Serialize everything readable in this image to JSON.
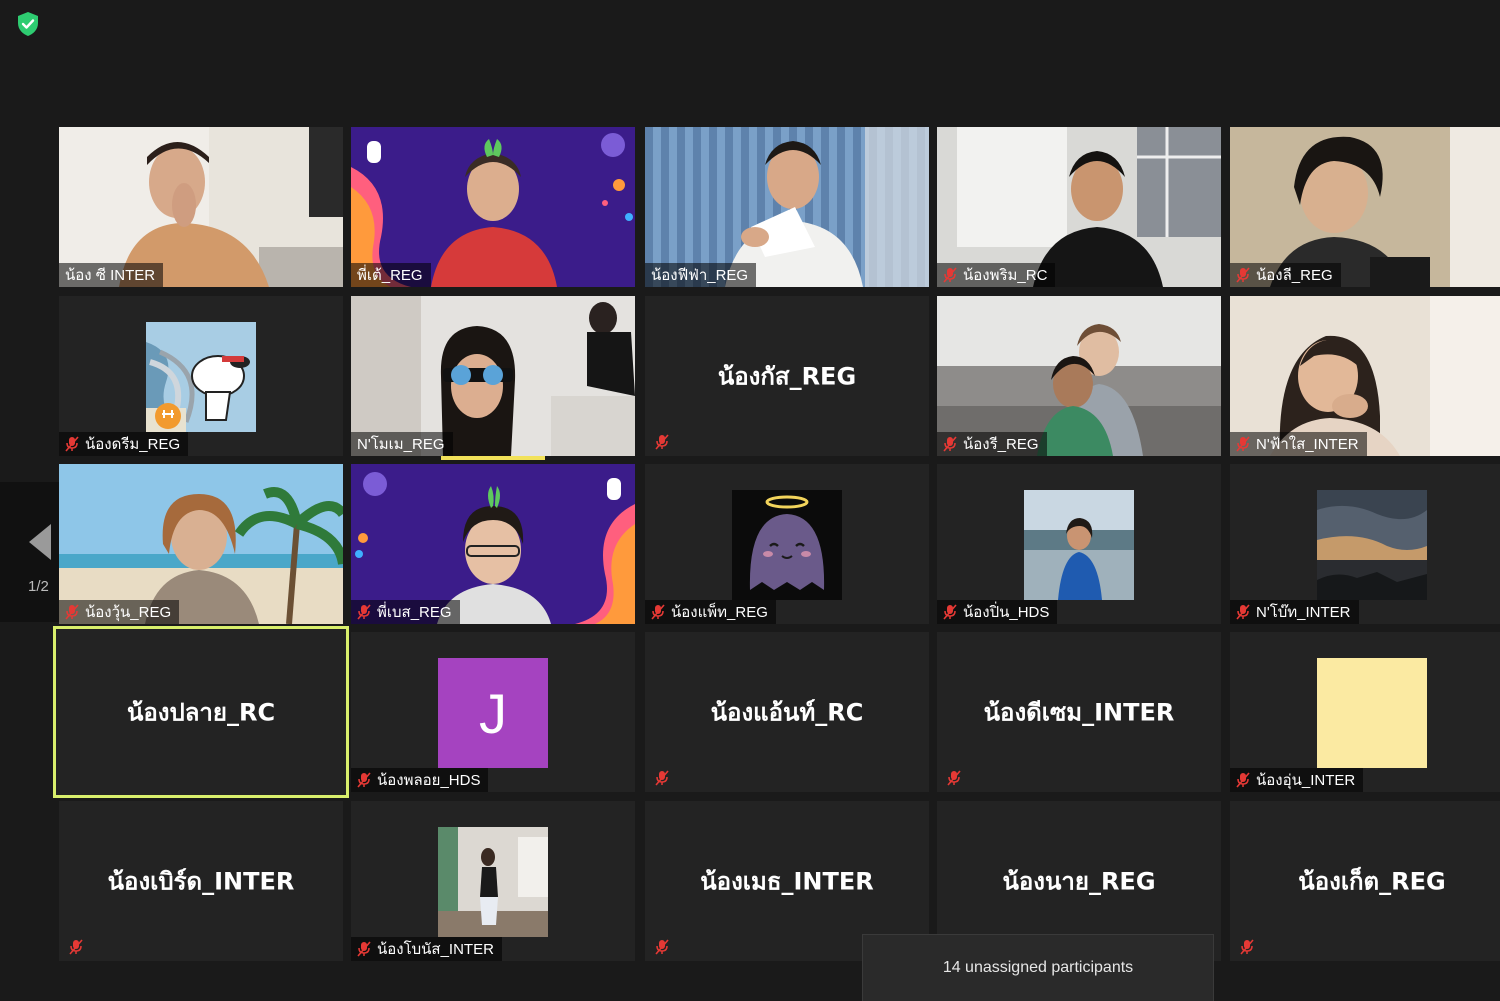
{
  "pagination": {
    "page_indicator": "1/2"
  },
  "toast": {
    "text": "14 unassigned participants"
  },
  "colors": {
    "active_speaker_border": "#d9ef6c",
    "muted_icon": "#e53935",
    "shield": "#2ecc71"
  },
  "participants": [
    {
      "name": "น้อง ซี INTER",
      "muted": false
    },
    {
      "name": "พี่เต้_REG",
      "muted": false
    },
    {
      "name": "น้องฟีฟ่า_REG",
      "muted": false
    },
    {
      "name": "น้องพริม_RC",
      "muted": true
    },
    {
      "name": "น้องลี_REG",
      "muted": true
    },
    {
      "name": "น้องดรีม_REG",
      "muted": true
    },
    {
      "name": "N'โมเม_REG",
      "muted": false
    },
    {
      "name": "น้องกัส_REG",
      "muted": true,
      "display_name": "น้องกัส_REG"
    },
    {
      "name": "น้องรี_REG",
      "muted": true
    },
    {
      "name": "N'ฟ้าใส_INTER",
      "muted": true
    },
    {
      "name": "น้องวุ้น_REG",
      "muted": true
    },
    {
      "name": "พี่เบส_REG",
      "muted": true
    },
    {
      "name": "น้องแพ็ท_REG",
      "muted": true
    },
    {
      "name": "น้องปิ่น_HDS",
      "muted": true
    },
    {
      "name": "N'โบ๊ท_INTER",
      "muted": true
    },
    {
      "name": "น้องปลาย_RC",
      "muted": false,
      "display_name": "น้องปลาย_RC",
      "active": true
    },
    {
      "name": "น้องพลอย_HDS",
      "muted": true,
      "avatar_letter": "J"
    },
    {
      "name": "น้องแอ้นท์_RC",
      "muted": true,
      "display_name": "น้องแอ้นท์_RC"
    },
    {
      "name": "น้องดีเซม_INTER",
      "muted": true,
      "display_name": "น้องดีเซม_INTER"
    },
    {
      "name": "น้องอุ่น_INTER",
      "muted": true
    },
    {
      "name": "น้องเบิร์ด_INTER",
      "muted": true,
      "display_name": "น้องเบิร์ด_INTER"
    },
    {
      "name": "น้องโบนัส_INTER",
      "muted": true
    },
    {
      "name": "น้องเมธ_INTER",
      "muted": true,
      "display_name": "น้องเมธ_INTER"
    },
    {
      "name": "น้องนาย_REG",
      "muted": true,
      "display_name": "น้องนาย_REG"
    },
    {
      "name": "น้องเก็ต_REG",
      "muted": true,
      "display_name": "น้องเก็ต_REG"
    }
  ]
}
